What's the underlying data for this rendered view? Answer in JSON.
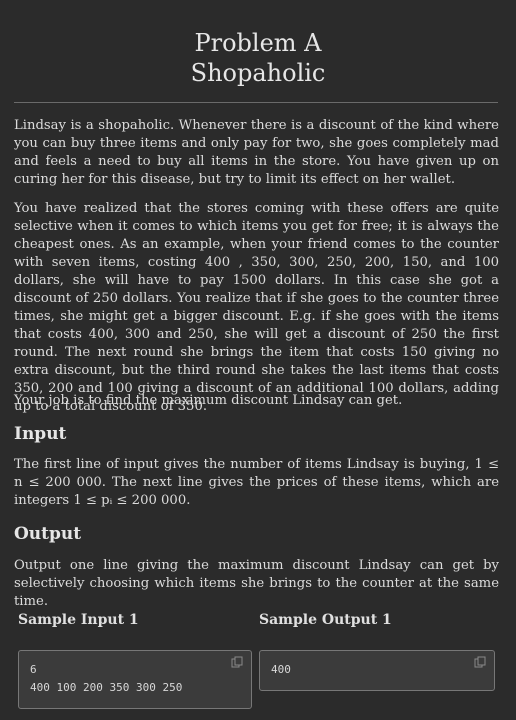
{
  "title": {
    "line1": "Problem A",
    "line2": "Shopaholic"
  },
  "statement": {
    "p1": "Lindsay is a shopaholic. Whenever there is a discount of the kind where you can buy three items and only pay for two, she goes completely mad and feels a need to buy all items in the store. You have given up on curing her for this disease, but try to limit its effect on her wallet.",
    "p2": "You have realized that the stores coming with these offers are quite selective when it comes to which items you get for free; it is always the cheapest ones. As an example, when your friend comes to the counter with seven items, costing 400 , 350, 300, 250, 200, 150, and 100 dollars, she will have to pay 1500 dollars. In this case she got a discount of 250 dollars. You realize that if she goes to the counter three times, she might get a bigger discount. E.g. if she goes with the items that costs 400, 300 and 250, she will get a discount of 250 the first round. The next round she brings the item that costs 150 giving no extra discount, but the third round she takes the last items that costs 350, 200 and 100 giving a discount of an additional 100 dollars, adding up to a total discount of 350.",
    "p3": "Your job is to find the maximum discount Lindsay can get."
  },
  "input_section": {
    "heading": "Input",
    "text": "The first line of input gives the number of items Lindsay is buying, 1 ≤ n ≤ 200 000. The next line gives the prices of these items, which are integers 1 ≤ pᵢ ≤ 200 000."
  },
  "output_section": {
    "heading": "Output",
    "text": "Output one line giving the maximum discount Lindsay can get by selectively choosing which items she brings to the counter at the same time."
  },
  "samples": {
    "input_label": "Sample Input 1",
    "output_label": "Sample Output 1",
    "input_line1": "6",
    "input_line2": "400 100 200 350 300 250",
    "output_line1": "400"
  }
}
